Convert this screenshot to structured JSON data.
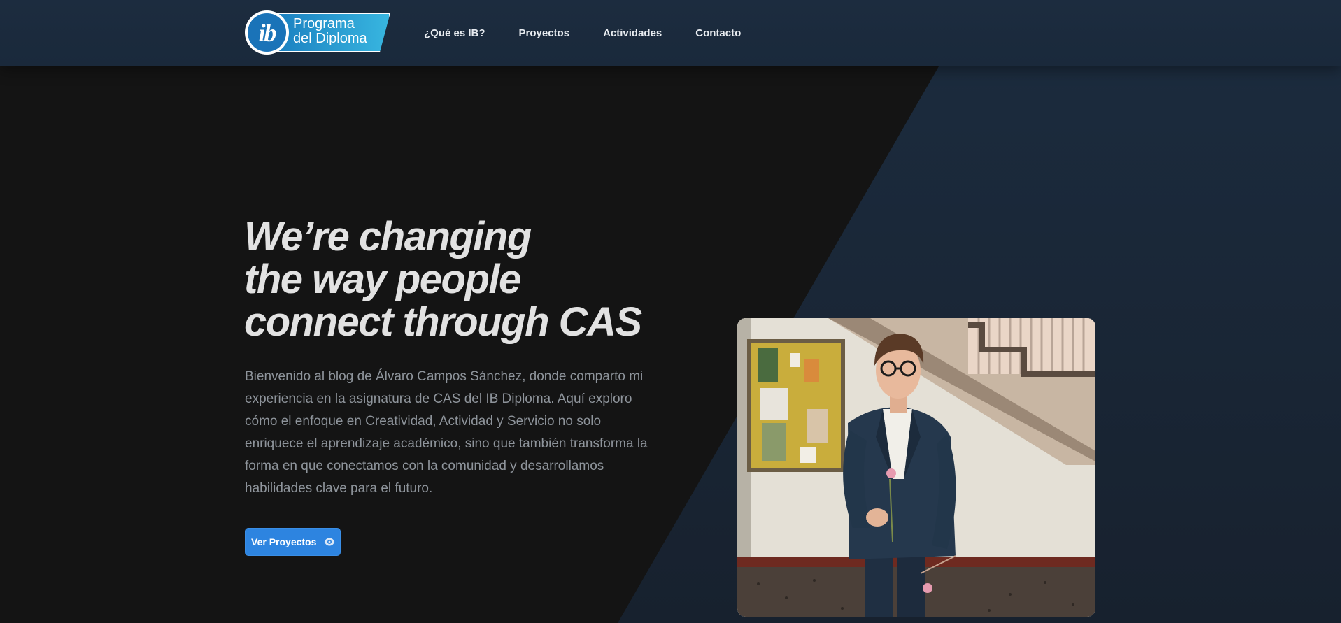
{
  "header": {
    "logo": {
      "mark": "ib",
      "line1": "Programa",
      "line2": "del Diploma"
    },
    "nav": [
      {
        "label": "¿Qué es IB?"
      },
      {
        "label": "Proyectos"
      },
      {
        "label": "Actividades"
      },
      {
        "label": "Contacto"
      }
    ]
  },
  "hero": {
    "title_lines": [
      "We’re changing",
      "the way people",
      "connect through CAS"
    ],
    "description": "Bienvenido al blog de Álvaro Campos Sánchez, donde comparto mi experiencia en la asignatura de CAS del IB Diploma. Aquí exploro cómo el enfoque en Creatividad, Actividad y Servicio no solo enriquece el aprendizaje académico, sino que también transforma la forma en que conectamos con la comunidad y desarrollamos habilidades clave para el futuro.",
    "cta": {
      "label": "Ver Proyectos",
      "icon": "eye-icon"
    }
  },
  "colors": {
    "background": "#141414",
    "header": "#1c2c3f",
    "accent": "#2d84e0",
    "title": "#e2e2e2",
    "body_text": "#8e949b"
  }
}
